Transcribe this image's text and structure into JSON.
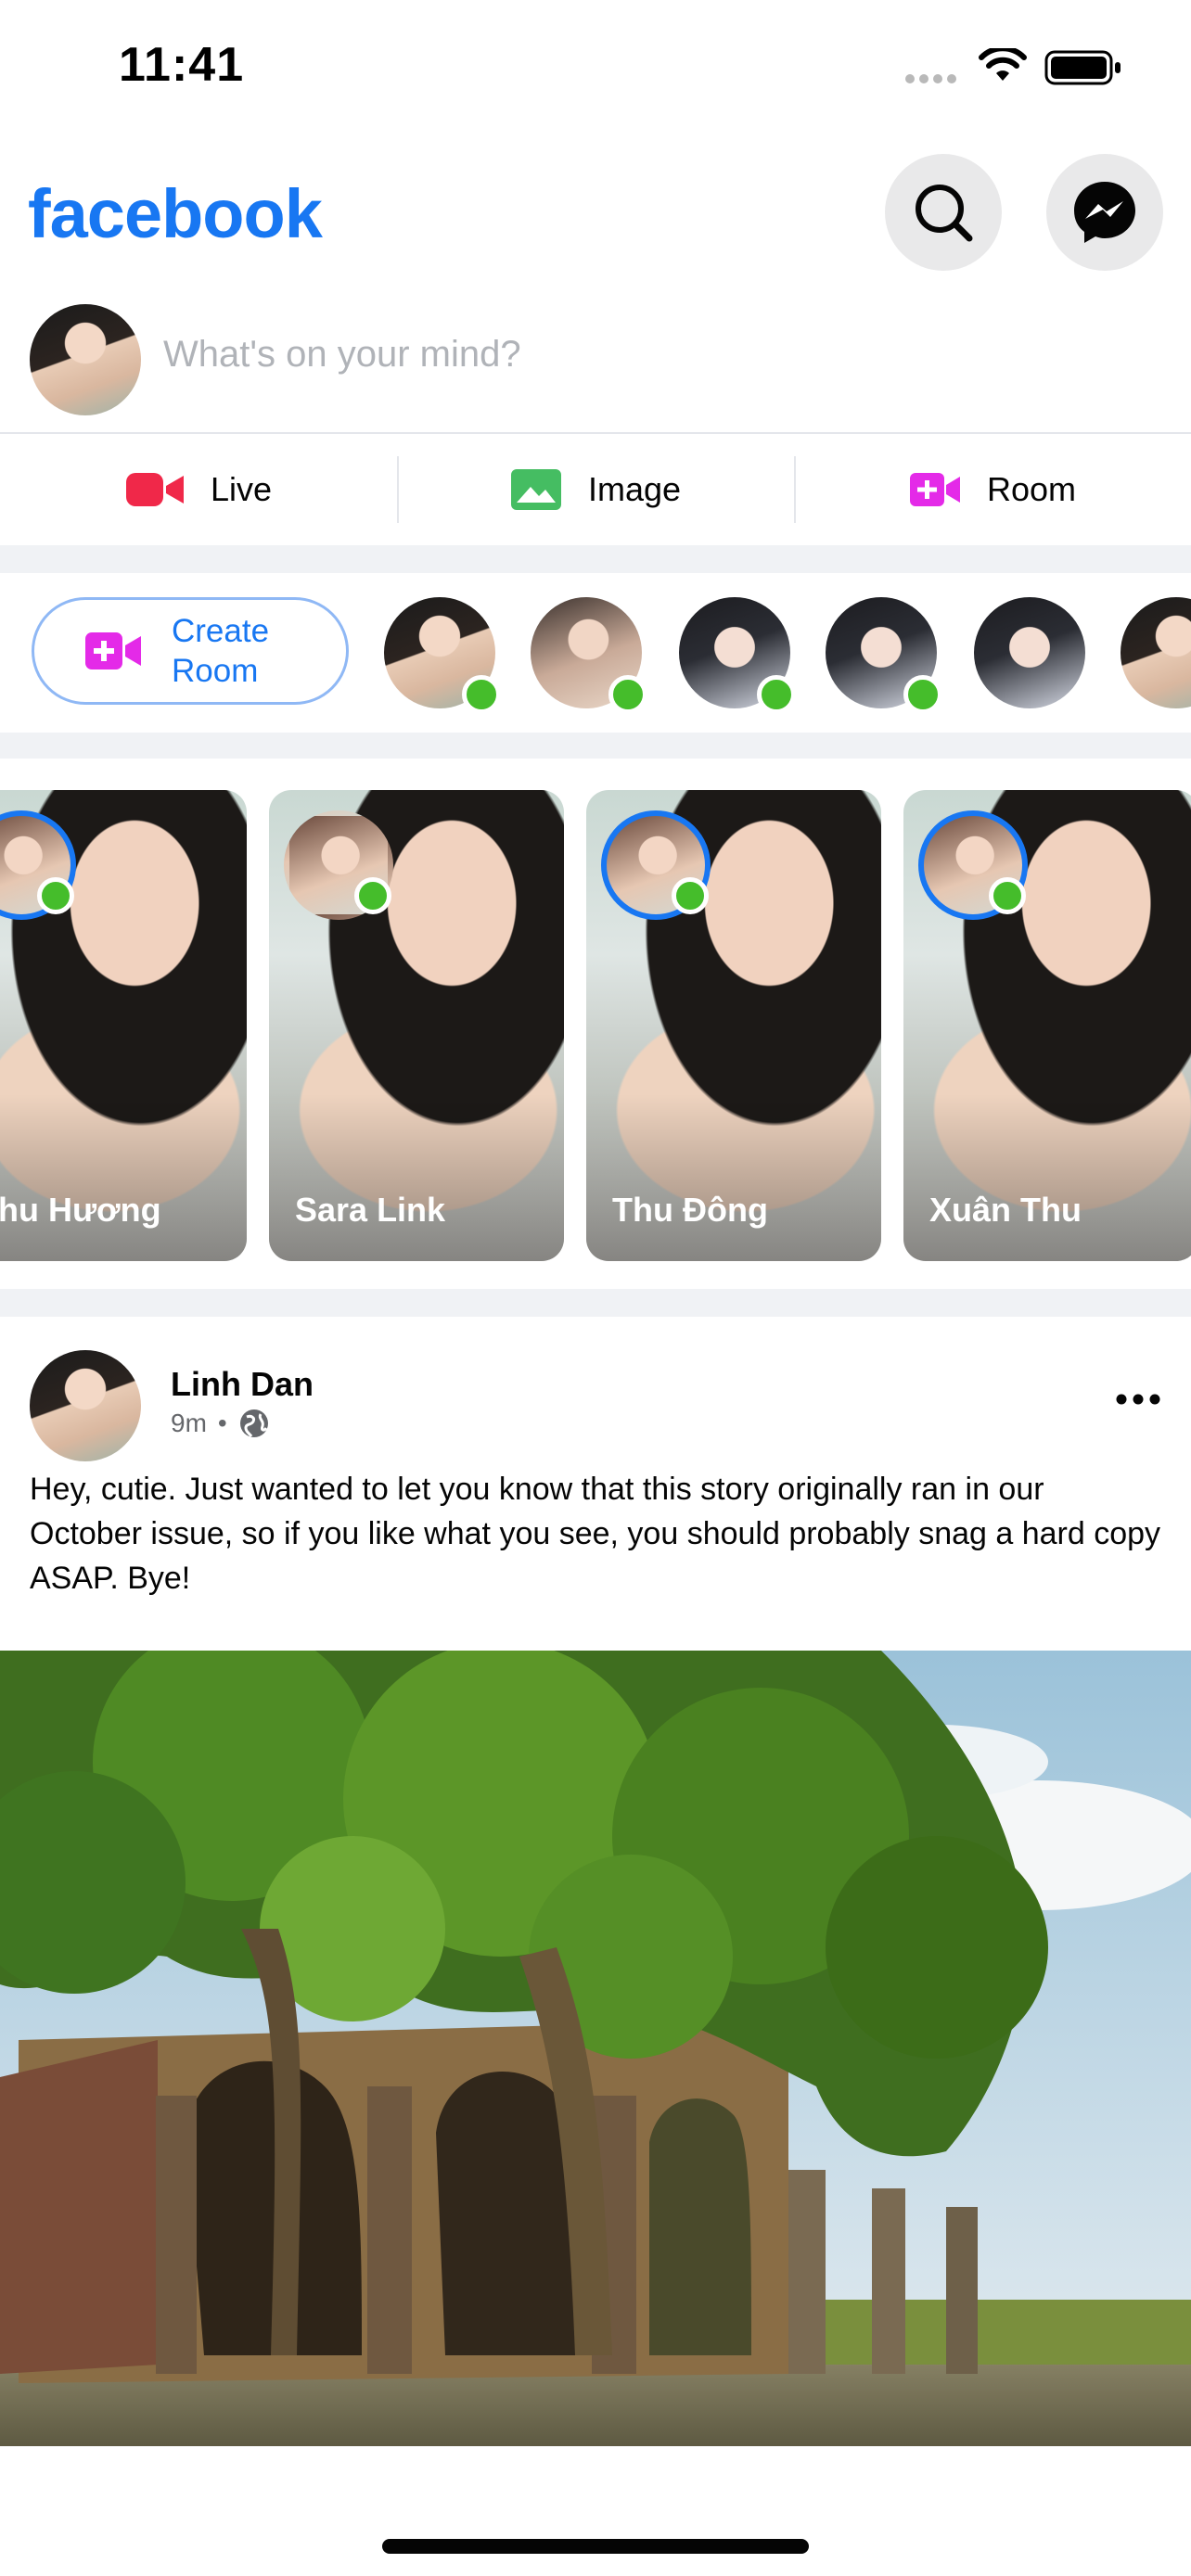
{
  "status_bar": {
    "time": "11:41",
    "icons": [
      "signal-dots-icon",
      "wifi-icon",
      "battery-icon"
    ]
  },
  "header": {
    "brand": "facebook",
    "icons": [
      "search-icon",
      "messenger-icon"
    ]
  },
  "composer": {
    "placeholder": "What's on your mind?"
  },
  "actions": [
    {
      "label": "Live",
      "icon": "live-video-icon",
      "color": "#f02849"
    },
    {
      "label": "Image",
      "icon": "image-icon",
      "color": "#45bd62"
    },
    {
      "label": "Room",
      "icon": "room-icon",
      "color": "#e42ae8"
    }
  ],
  "rooms": {
    "create_label": "Create Room",
    "create_icon": "room-icon",
    "online_color": "#45bd2b"
  },
  "stories": [
    {
      "name": "Thu Hương"
    },
    {
      "name": "Sara Link"
    },
    {
      "name": "Thu Đông"
    },
    {
      "name": "Xuân Thu"
    }
  ],
  "post": {
    "author": "Linh Dan",
    "time": "9m",
    "separator": "•",
    "privacy_icon": "globe-icon",
    "text": "Hey, cutie. Just wanted to let you know that this story originally ran in our October issue, so if you like what you see, you should probably snag a hard copy ASAP. Bye!",
    "more_icon": "more-horizontal-icon"
  },
  "colors": {
    "brand": "#1877f2",
    "divider": "#e4e6eb",
    "section_background": "#f0f2f5"
  }
}
